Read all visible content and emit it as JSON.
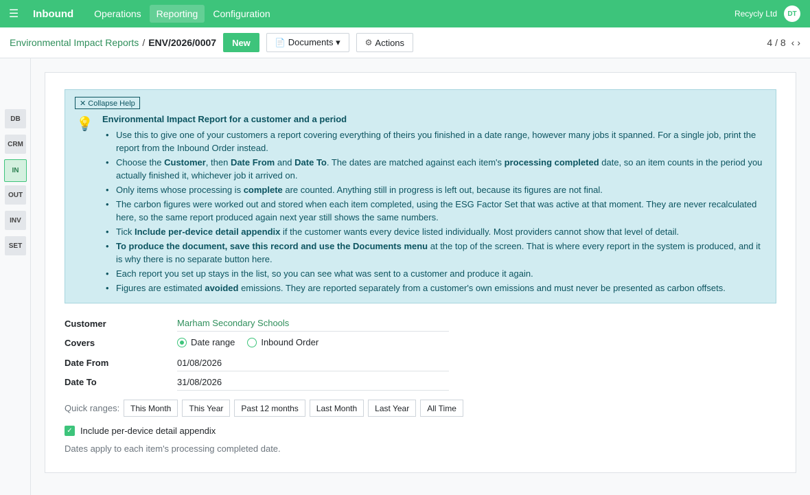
{
  "navbar": {
    "app_name": "Inbound",
    "menu": [
      "Operations",
      "Reporting",
      "Configuration"
    ],
    "active_menu": "Reporting",
    "company": "Recycly Ltd",
    "avatar_initials": "DT"
  },
  "control": {
    "breadcrumb_parent": "Environmental Impact Reports",
    "breadcrumb_sep": "/",
    "breadcrumb_current": "ENV/2026/0007",
    "new_label": "New",
    "documents_label": "Documents ▾",
    "actions_label": "Actions",
    "pager": "4 / 8"
  },
  "sidenav": {
    "items": [
      "DB",
      "CRM",
      "IN",
      "OUT",
      "INV",
      "SET"
    ],
    "active": "IN"
  },
  "help": {
    "collapse_label": "✕ Collapse Help",
    "title": "Environmental Impact Report for a customer and a period",
    "items": [
      "Use this to give one of your customers a report covering everything of theirs you finished in a date range, however many jobs it spanned. For a single job, print the report from the Inbound Order instead.",
      "Choose the <b>Customer</b>, then <b>Date From</b> and <b>Date To</b>. The dates are matched against each item's <b>processing completed</b> date, so an item counts in the period you actually finished it, whichever job it arrived on.",
      "Only items whose processing is <b>complete</b> are counted. Anything still in progress is left out, because its figures are not final.",
      "The carbon figures were worked out and stored when each item completed, using the ESG Factor Set that was active at that moment. They are never recalculated here, so the same report produced again next year still shows the same numbers.",
      "Tick <b>Include per-device detail appendix</b> if the customer wants every device listed individually. Most providers cannot show that level of detail.",
      "<b>To produce the document, save this record and use the Documents menu</b> at the top of the screen. That is where every report in the system is produced, and it is why there is no separate button here.",
      "Each report you set up stays in the list, so you can see what was sent to a customer and produce it again.",
      "Figures are estimated <b>avoided</b> emissions. They are reported separately from a customer's own emissions and must never be presented as carbon offsets."
    ]
  },
  "form": {
    "customer_label": "Customer",
    "customer_value": "Marham Secondary Schools",
    "covers_label": "Covers",
    "covers_options": [
      "Date range",
      "Inbound Order"
    ],
    "covers_selected": "Date range",
    "date_from_label": "Date From",
    "date_from_value": "01/08/2026",
    "date_to_label": "Date To",
    "date_to_value": "31/08/2026",
    "quick_label": "Quick ranges:",
    "quick_ranges": [
      "This Month",
      "This Year",
      "Past 12 months",
      "Last Month",
      "Last Year",
      "All Time"
    ],
    "appendix_label": "Include per-device detail appendix",
    "appendix_checked": true,
    "hint": "Dates apply to each item's processing completed date."
  },
  "colors": {
    "brand": "#3dc47b",
    "help_bg": "#d1ecf1",
    "link": "#2f8f5b"
  }
}
